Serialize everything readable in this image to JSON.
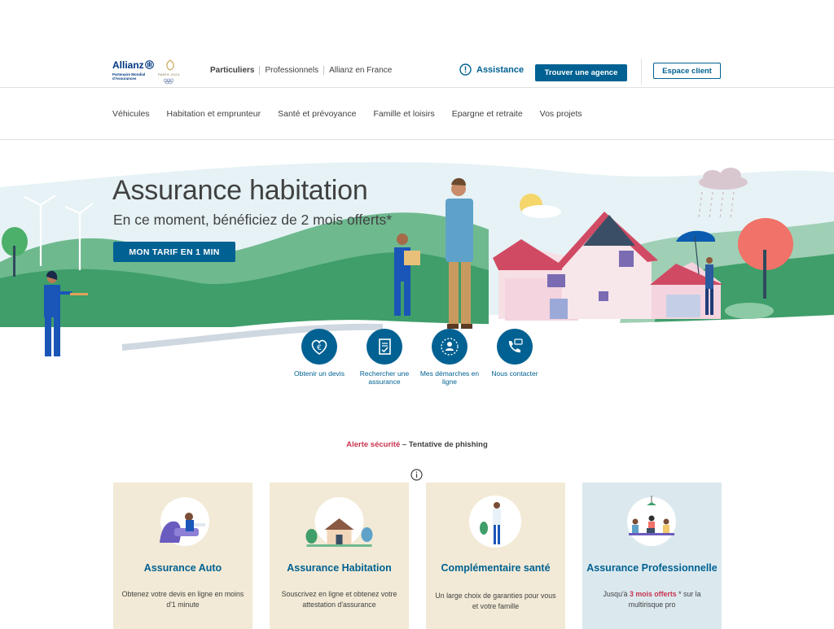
{
  "brand": {
    "name": "Allianz",
    "tagline": "Partenaire Mondial d'Assurances",
    "olympics": "PARIS 2024"
  },
  "segments": [
    "Particuliers",
    "Professionnels",
    "Allianz en France"
  ],
  "header": {
    "assistance": "Assistance",
    "agence_button": "Trouver une agence",
    "espace_button": "Espace client"
  },
  "nav": [
    "Véhicules",
    "Habitation et emprunteur",
    "Santé et prévoyance",
    "Famille et loisirs",
    "Epargne et retraite",
    "Vos projets"
  ],
  "hero": {
    "title": "Assurance habitation",
    "subtitle": "En ce moment, bénéficiez de 2 mois offerts*",
    "cta": "MON TARIF EN 1 MIN"
  },
  "actions": [
    {
      "label": "Obtenir un devis",
      "icon": "euro-heart-icon"
    },
    {
      "label": "Rechercher une assurance",
      "icon": "document-check-icon"
    },
    {
      "label": "Mes démarches en ligne",
      "icon": "user-stars-icon"
    },
    {
      "label": "Nous contacter",
      "icon": "phone-chat-icon"
    }
  ],
  "alert": {
    "label": "Alerte sécurité",
    "separator": " – ",
    "text": "Tentative de phishing"
  },
  "cards": [
    {
      "title": "Assurance Auto",
      "desc": "Obtenez votre devis en ligne en moins d'1 minute"
    },
    {
      "title": "Assurance Habitation",
      "desc": "Souscrivez en ligne et obtenez votre attestation d'assurance"
    },
    {
      "title": "Complémentaire santé",
      "desc": "Un large choix de garanties pour vous et votre famille"
    },
    {
      "title": "Assurance Professionnelle",
      "desc_pre": "Jusqu'à ",
      "desc_hl": "3 mois offerts",
      "desc_post": " * sur la multirisque pro"
    }
  ],
  "colors": {
    "primary": "#006192",
    "brand_blue": "#003781",
    "alert_red": "#c8334f",
    "card_beige": "#f2ead6",
    "card_blue": "#dbe9ee"
  }
}
